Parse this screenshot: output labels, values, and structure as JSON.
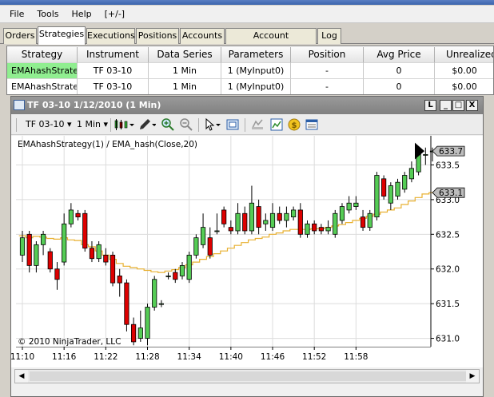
{
  "menu": [
    "File",
    "Tools",
    "Help",
    "[+/-]"
  ],
  "tabs": [
    "Orders",
    "Strategies",
    "Executions",
    "Positions",
    "Accounts",
    "Account Performance",
    "Log"
  ],
  "active_tab": "Strategies",
  "grid": {
    "columns": [
      "Strategy",
      "Instrument",
      "Data Series",
      "Parameters",
      "Position",
      "Avg Price",
      "Unrealized"
    ],
    "rows": [
      [
        "EMAhashStrate",
        "TF 03-10",
        "1 Min",
        "1 (MyInput0)",
        "-",
        "0",
        "$0.00"
      ],
      [
        "EMAhashStrate",
        "TF 03-10",
        "1 Min",
        "1 (MyInput0)",
        "-",
        "0",
        "$0.00"
      ]
    ],
    "active_color": "#90ee90"
  },
  "chart_window": {
    "title": "TF 03-10  1/12/2010 (1 Min)",
    "buttons": [
      "L",
      "_",
      "□",
      "X"
    ],
    "toolbar": {
      "instrument": "TF 03-10",
      "interval": "1 Min"
    }
  },
  "chart_data": {
    "type": "candlestick",
    "title": "EMAhashStrategy(1) / EMA_hash(Close,20)",
    "copyright": "© 2010 NinjaTrader, LLC",
    "ylim": [
      630.88,
      633.92
    ],
    "yticks": [
      "631.0",
      "631.5",
      "632.0",
      "632.5",
      "633.0",
      "633.5"
    ],
    "xticks": [
      "11:10",
      "11:16",
      "11:22",
      "11:28",
      "11:34",
      "11:40",
      "11:46",
      "11:52",
      "11:58"
    ],
    "current_price_label": "633.7",
    "ema_label": "633.1",
    "grid": true,
    "up_color": "#55cc55",
    "down_color": "#dd0000",
    "ema_color": "#e8b030",
    "candles": [
      [
        632.2,
        632.45,
        632.1,
        632.55
      ],
      [
        632.5,
        632.05,
        631.95,
        632.55
      ],
      [
        632.05,
        632.35,
        631.95,
        632.4
      ],
      [
        632.35,
        632.5,
        632.2,
        632.55
      ],
      [
        632.25,
        632.0,
        631.95,
        632.3
      ],
      [
        632.0,
        631.85,
        631.7,
        632.1
      ],
      [
        632.1,
        632.65,
        632.05,
        632.8
      ],
      [
        632.65,
        632.85,
        632.6,
        632.95
      ],
      [
        632.8,
        632.75,
        632.7,
        632.85
      ],
      [
        632.8,
        632.3,
        632.25,
        632.85
      ],
      [
        632.3,
        632.15,
        632.1,
        632.4
      ],
      [
        632.15,
        632.35,
        632.1,
        632.4
      ],
      [
        632.2,
        632.1,
        632.05,
        632.3
      ],
      [
        632.2,
        631.8,
        631.75,
        632.25
      ],
      [
        631.9,
        631.8,
        631.6,
        632.0
      ],
      [
        631.8,
        631.2,
        631.1,
        631.85
      ],
      [
        631.2,
        630.95,
        630.9,
        631.3
      ],
      [
        631.0,
        631.15,
        630.95,
        631.4
      ],
      [
        631.0,
        631.45,
        630.9,
        631.5
      ],
      [
        631.45,
        631.85,
        631.4,
        631.9
      ],
      [
        631.5,
        631.5,
        631.45,
        631.55
      ],
      [
        631.9,
        631.9,
        631.85,
        631.95
      ],
      [
        631.95,
        631.85,
        631.8,
        632.0
      ],
      [
        631.9,
        632.05,
        631.85,
        632.1
      ],
      [
        631.85,
        632.2,
        631.8,
        632.25
      ],
      [
        632.2,
        632.45,
        632.15,
        632.5
      ],
      [
        632.35,
        632.6,
        632.3,
        632.8
      ],
      [
        632.45,
        632.2,
        632.15,
        632.6
      ],
      [
        632.55,
        632.55,
        632.5,
        632.8
      ],
      [
        632.85,
        632.65,
        632.6,
        632.9
      ],
      [
        632.6,
        632.55,
        632.5,
        632.7
      ],
      [
        632.55,
        632.8,
        632.5,
        632.95
      ],
      [
        632.8,
        632.55,
        632.5,
        632.9
      ],
      [
        632.55,
        632.95,
        632.5,
        633.2
      ],
      [
        632.9,
        632.6,
        632.5,
        633.0
      ],
      [
        632.65,
        632.7,
        632.55,
        632.8
      ],
      [
        632.6,
        632.8,
        632.55,
        632.95
      ],
      [
        632.8,
        632.7,
        632.65,
        632.9
      ],
      [
        632.7,
        632.8,
        632.6,
        632.9
      ],
      [
        632.75,
        632.85,
        632.7,
        632.9
      ],
      [
        632.85,
        632.5,
        632.45,
        632.95
      ],
      [
        632.5,
        632.65,
        632.45,
        632.7
      ],
      [
        632.65,
        632.55,
        632.5,
        632.7
      ],
      [
        632.6,
        632.55,
        632.5,
        632.65
      ],
      [
        632.55,
        632.6,
        632.5,
        632.7
      ],
      [
        632.5,
        632.8,
        632.45,
        632.85
      ],
      [
        632.7,
        632.9,
        632.65,
        632.95
      ],
      [
        632.85,
        632.95,
        632.8,
        633.05
      ],
      [
        632.9,
        632.95,
        632.85,
        633.05
      ],
      [
        632.75,
        632.6,
        632.55,
        632.85
      ],
      [
        632.6,
        632.8,
        632.55,
        632.85
      ],
      [
        632.75,
        633.35,
        632.7,
        633.4
      ],
      [
        633.3,
        633.05,
        633.0,
        633.35
      ],
      [
        632.95,
        633.2,
        632.85,
        633.25
      ],
      [
        633.05,
        633.25,
        633.0,
        633.3
      ],
      [
        633.15,
        633.35,
        633.1,
        633.4
      ],
      [
        633.3,
        633.45,
        633.25,
        633.55
      ],
      [
        633.4,
        633.65,
        633.35,
        633.7
      ],
      [
        633.65,
        633.65,
        633.5,
        633.75
      ],
      [
        633.7,
        633.7,
        633.55,
        633.75
      ]
    ],
    "ema": [
      632.48,
      632.45,
      632.47,
      632.46,
      632.44,
      632.43,
      632.45,
      632.42,
      632.41,
      632.35,
      632.32,
      632.26,
      632.2,
      632.14,
      632.08,
      632.04,
      632.02,
      632.0,
      631.98,
      631.96,
      631.95,
      631.97,
      631.99,
      632.02,
      632.06,
      632.1,
      632.14,
      632.18,
      632.22,
      632.26,
      632.3,
      632.34,
      632.38,
      632.42,
      632.44,
      632.46,
      632.5,
      632.52,
      632.55,
      632.57,
      632.57,
      632.57,
      632.58,
      632.58,
      632.6,
      632.62,
      632.64,
      632.67,
      632.7,
      632.73,
      632.76,
      632.79,
      632.82,
      632.85,
      632.88,
      632.93,
      632.98,
      633.03,
      633.08,
      633.1
    ]
  }
}
